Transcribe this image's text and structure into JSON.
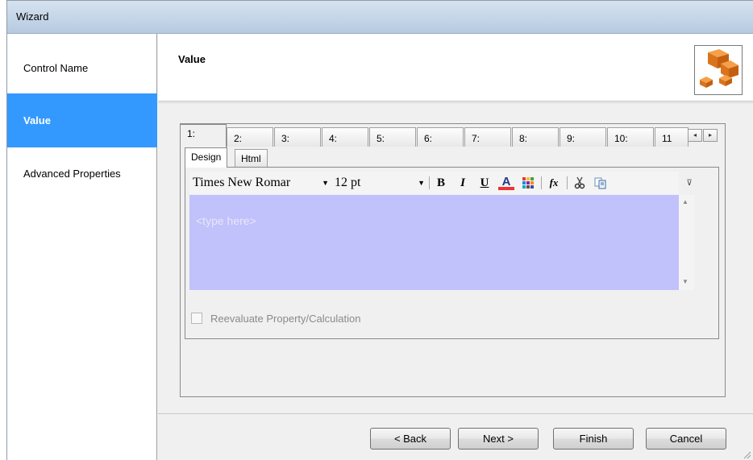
{
  "window": {
    "title": "Wizard"
  },
  "sidebar": {
    "items": [
      {
        "label": "Control Name",
        "selected": false
      },
      {
        "label": "Value",
        "selected": true
      },
      {
        "label": "Advanced Properties",
        "selected": false
      }
    ]
  },
  "header": {
    "title": "Value",
    "logo_icon": "orange-cubes-icon"
  },
  "value_tabs": {
    "tabs": [
      "1:",
      "2:",
      "3:",
      "4:",
      "5:",
      "6:",
      "7:",
      "8:",
      "9:",
      "10:",
      "11"
    ],
    "active_index": 0,
    "scroll_left": "◂",
    "scroll_right": "▸"
  },
  "editor": {
    "tabs": [
      {
        "label": "Design",
        "active": true
      },
      {
        "label": "Html",
        "active": false
      }
    ],
    "toolbar": {
      "font_family": "Times New Romar",
      "font_size": "12 pt",
      "bold": "B",
      "italic": "I",
      "underline": "U",
      "font_color": "A",
      "function": "fx",
      "overflow": "⊽"
    },
    "placeholder": "<type here>",
    "area_color": "#c1c1fb"
  },
  "reevaluate": {
    "label": "Reevaluate Property/Calculation",
    "checked": false,
    "enabled": false
  },
  "buttons": {
    "back": "< Back",
    "next": "Next >",
    "finish": "Finish",
    "cancel": "Cancel"
  },
  "colors": {
    "selection": "#3399ff",
    "accent_orange": "#e8862a"
  }
}
